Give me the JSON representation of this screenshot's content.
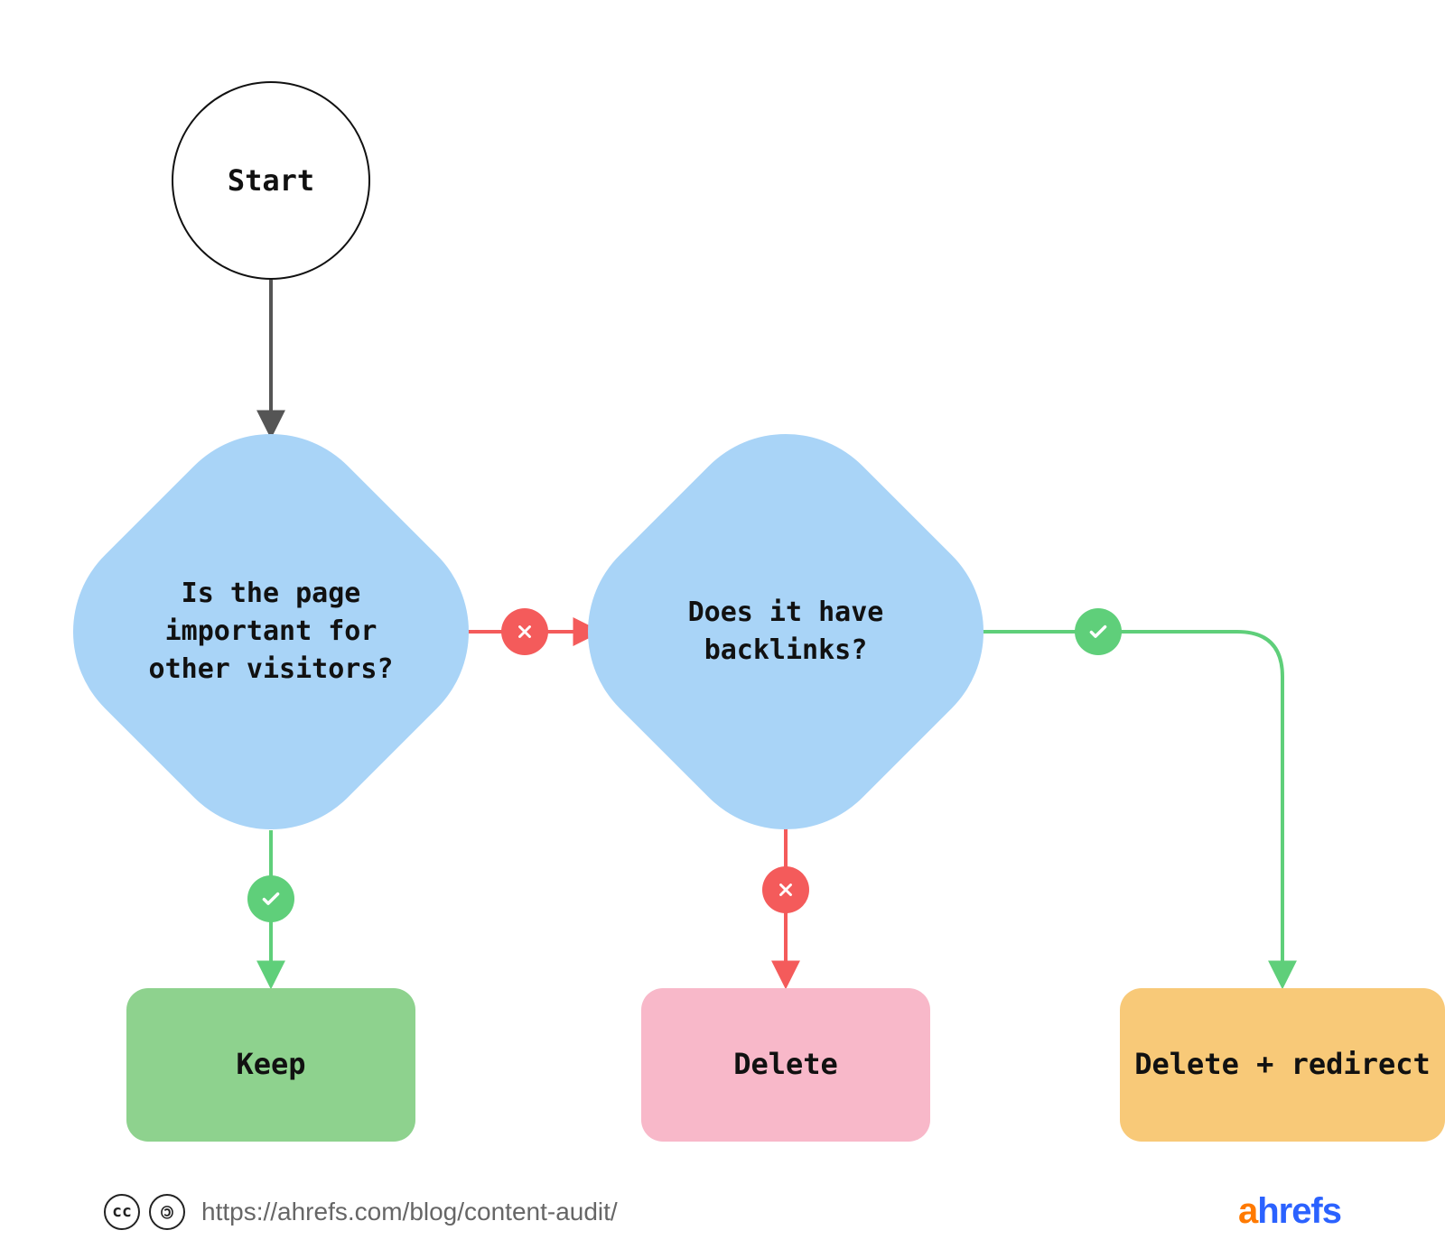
{
  "colors": {
    "decision_fill": "#a9d4f7",
    "keep_fill": "#8ed28e",
    "delete_fill": "#f8b8c9",
    "delete_redirect_fill": "#f8c978",
    "yes_edge": "#5fcf7a",
    "no_edge": "#f45b5b",
    "neutral_edge": "#555555"
  },
  "nodes": {
    "start": {
      "label": "Start"
    },
    "decision1": {
      "label": "Is the page important for other visitors?"
    },
    "decision2": {
      "label": "Does it have backlinks?"
    },
    "action_keep": {
      "label": "Keep"
    },
    "action_delete": {
      "label": "Delete"
    },
    "action_delete_redirect": {
      "label": "Delete + redirect"
    }
  },
  "edges": {
    "start_to_d1": {
      "type": "neutral"
    },
    "d1_yes": {
      "type": "yes",
      "to": "action_keep"
    },
    "d1_no": {
      "type": "no",
      "to": "decision2"
    },
    "d2_no": {
      "type": "no",
      "to": "action_delete"
    },
    "d2_yes": {
      "type": "yes",
      "to": "action_delete_redirect"
    }
  },
  "footer": {
    "license_icons": [
      "cc",
      "by"
    ],
    "url": "https://ahrefs.com/blog/content-audit/",
    "logo_a": "a",
    "logo_rest": "hrefs"
  }
}
